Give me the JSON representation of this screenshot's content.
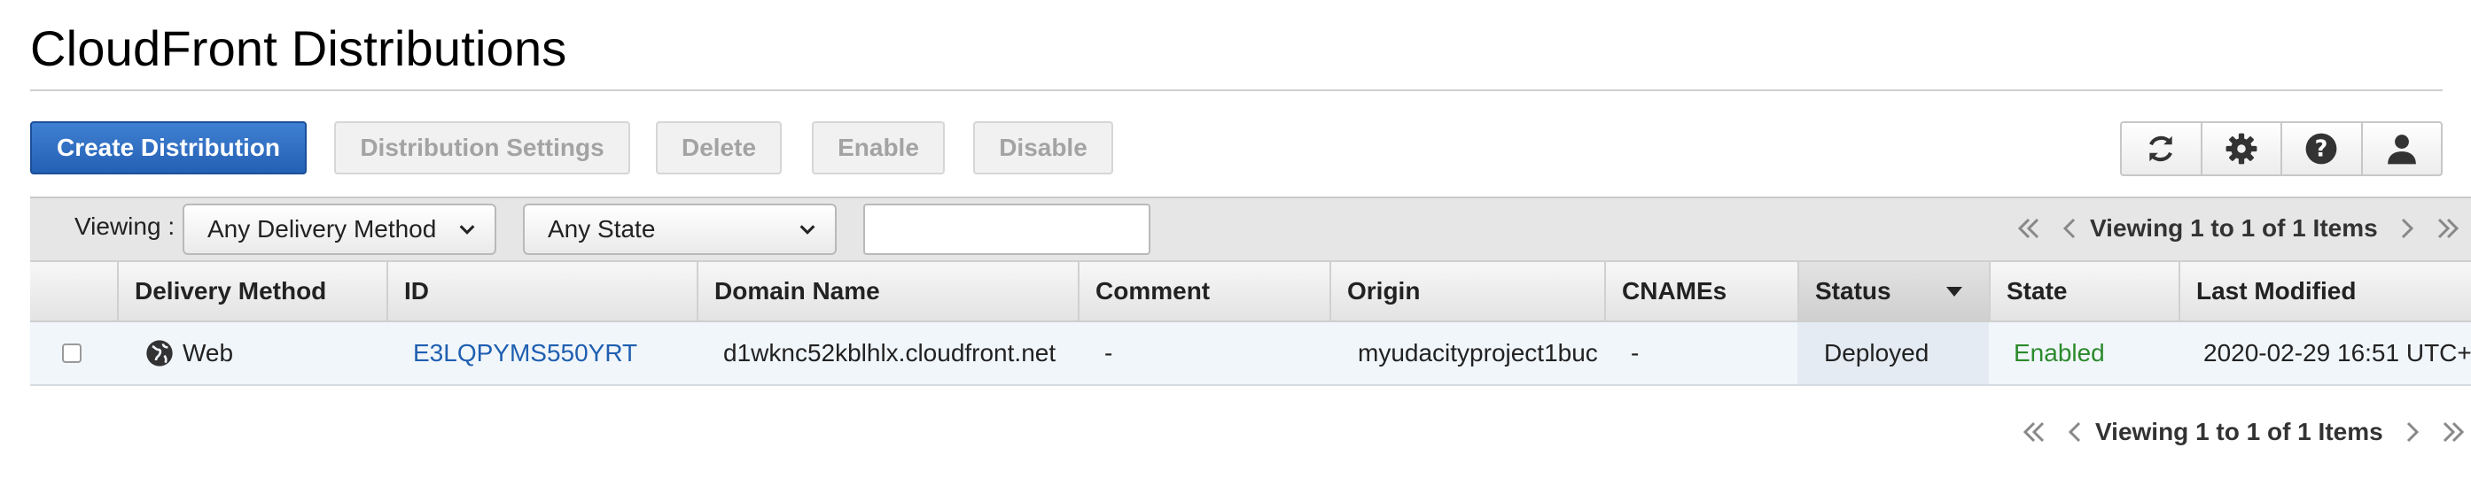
{
  "page": {
    "title": "CloudFront Distributions"
  },
  "actions": {
    "create": "Create Distribution",
    "settings": "Distribution Settings",
    "delete": "Delete",
    "enable": "Enable",
    "disable": "Disable"
  },
  "tool_icons": [
    "refresh-icon",
    "gear-icon",
    "help-icon",
    "user-icon"
  ],
  "filters": {
    "viewing_label": "Viewing :",
    "delivery_method": {
      "selected": "Any Delivery Method"
    },
    "state": {
      "selected": "Any State"
    },
    "search": {
      "value": "",
      "placeholder": ""
    }
  },
  "pagination": {
    "text": "Viewing 1 to 1 of 1 Items"
  },
  "table": {
    "columns": [
      "Delivery Method",
      "ID",
      "Domain Name",
      "Comment",
      "Origin",
      "CNAMEs",
      "Status",
      "State",
      "Last Modified"
    ],
    "sorted_column": "Status",
    "rows": [
      {
        "delivery_method": "Web",
        "id": "E3LQPYMS550YRT",
        "domain_name": "d1wknc52kblhlx.cloudfront.net",
        "comment": "-",
        "origin": "myudacityproject1buc",
        "cnames": "-",
        "status": "Deployed",
        "state": "Enabled",
        "last_modified": "2020-02-29 16:51 UTC+"
      }
    ]
  },
  "colors": {
    "primary": "#2c6cc3",
    "link": "#1f5fb0",
    "enabled": "#2b8a2b",
    "row_highlight": "#f1f6fb"
  }
}
